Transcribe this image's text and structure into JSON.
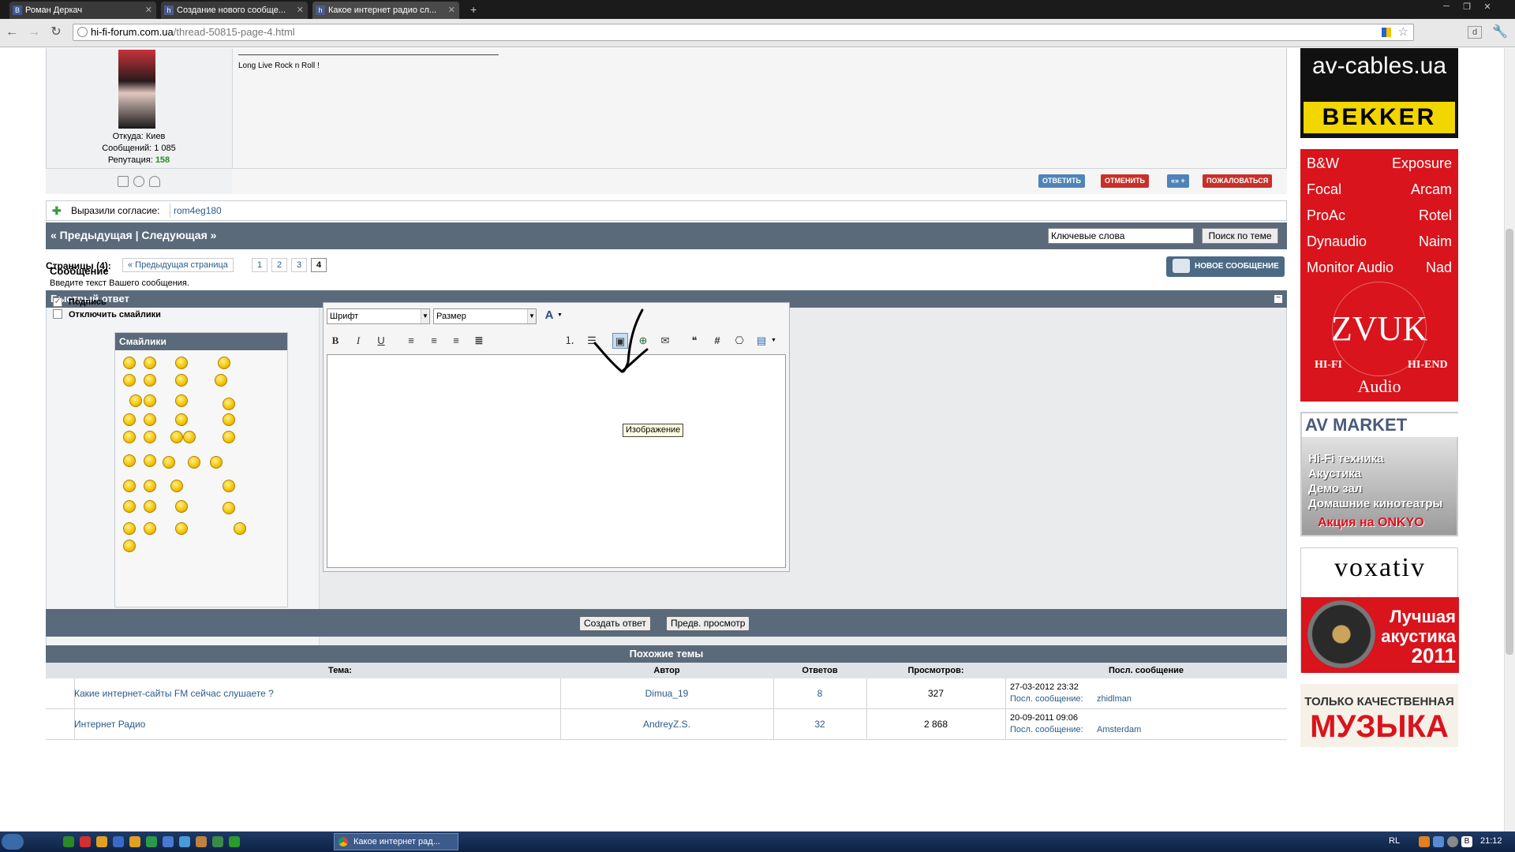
{
  "browser": {
    "tabs": [
      {
        "icon": "В",
        "label": "Роман Деркач"
      },
      {
        "icon": "hifi",
        "label": "Создание нового сообще..."
      },
      {
        "icon": "hifi",
        "label": "Какое интернет радио сл..."
      }
    ],
    "url_host": "hi-fi-forum.com.ua",
    "url_path": "/thread-50815-page-4.html"
  },
  "post": {
    "signature": "Long Live Rock n Roll !",
    "user_from": "Откуда: Киев",
    "user_posts": "Сообщений: 1 085",
    "user_rep_label": "Репутация:",
    "user_rep_value": "158",
    "buttons": {
      "reply": "ОТВЕТИТЬ",
      "cancel": "ОТМЕНИТЬ",
      "multi": "«» +",
      "report": "ПОЖАЛОВАТЬСЯ"
    }
  },
  "thanks": {
    "label": "Выразили согласие:",
    "user": "rom4eg180"
  },
  "nav": {
    "prev_next": "« Предыдущая | Следующая »",
    "search_placeholder": "Ключевые слова",
    "search_button": "Поиск по теме"
  },
  "pagination": {
    "label": "Страницы (4):",
    "prev": "« Предыдущая страница",
    "pages": [
      "1",
      "2",
      "3",
      "4"
    ],
    "current": "4",
    "new_message": "НОВОЕ СООБЩЕНИЕ"
  },
  "quick_reply": {
    "title": "Быстрый ответ",
    "message_label": "Сообщение",
    "message_hint": "Введите текст Вашего сообщения.",
    "signature_label": "Подпись",
    "disable_smilies_label": "Отключить смайлики",
    "smilies_title": "Смайлики",
    "font_select": "Шрифт",
    "size_select": "Размер",
    "tooltip": "Изображение",
    "submit": "Создать ответ",
    "preview": "Предв. просмотр"
  },
  "similar": {
    "title": "Похожие темы",
    "columns": [
      "Тема:",
      "Автор",
      "Ответов",
      "Просмотров:",
      "Посл. сообщение"
    ],
    "rows": [
      {
        "topic": "Какие интернет-сайты FM сейчас слушаете ?",
        "author": "Dimua_19",
        "replies": "8",
        "views": "327",
        "last_date": "27-03-2012 23:32",
        "last_prefix": "Посл. сообщение:",
        "last_user": "zhidlman"
      },
      {
        "topic": "Интернет Радио",
        "author": "AndreyZ.S.",
        "replies": "32",
        "views": "2 868",
        "last_date": "20-09-2011 09:06",
        "last_prefix": "Посл. сообщение:",
        "last_user": "Amsterdam"
      }
    ]
  },
  "ads": {
    "avcables": {
      "line1": "av-cables.ua",
      "line2": "BEKKER"
    },
    "zvuk": {
      "brands": [
        "B&W",
        "Exposure",
        "Focal",
        "Arcam",
        "ProAc",
        "Rotel",
        "Dynaudio",
        "Naim",
        "Monitor Audio",
        "Nad"
      ],
      "logo": "ZVUK",
      "left": "HI-FI",
      "right": "HI-END",
      "audio": "Audio"
    },
    "avmarket": {
      "logo": "AV MARKET",
      "lines": [
        "Hi-Fi техника",
        "Акустика",
        "Демо зал",
        "Домашние кинотеатры"
      ],
      "promo": "Акция на ONKYO"
    },
    "voxativ": {
      "logo": "voxativ",
      "lines": [
        "Лучшая",
        "акустика",
        "2011"
      ]
    },
    "music": {
      "line1": "ТОЛЬКО КАЧЕСТВЕННАЯ",
      "line2": "МУЗЫКА"
    }
  },
  "taskbar": {
    "item": "Какое интернет рад...",
    "lang": "RL",
    "time": "21:12"
  },
  "colors": {
    "header": "#5a6a7a",
    "link": "#2b5c8a",
    "ad_red": "#d9141c"
  }
}
